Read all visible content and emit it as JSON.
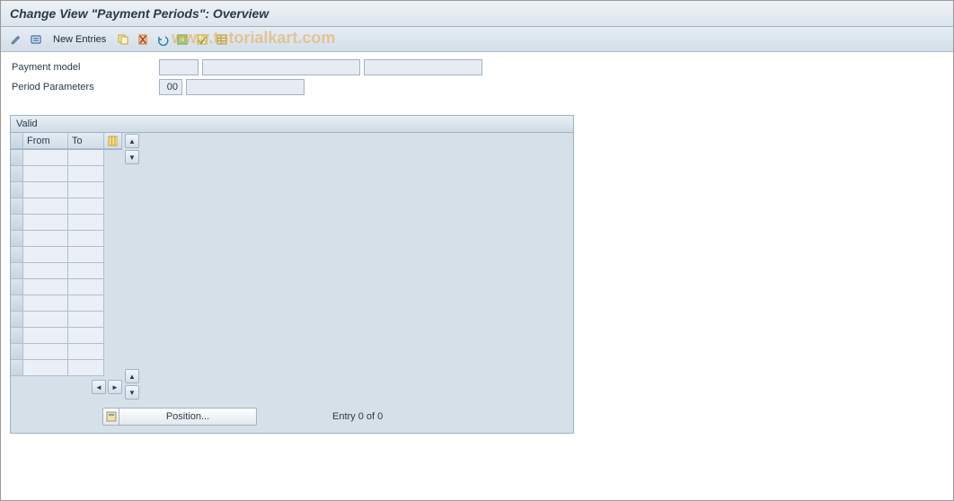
{
  "title": "Change View \"Payment Periods\": Overview",
  "watermark": "www.tutorialkart.com",
  "toolbar": {
    "new_entries": "New Entries"
  },
  "form": {
    "payment_model_label": "Payment model",
    "payment_model_code": "",
    "payment_model_desc1": "",
    "payment_model_desc2": "",
    "period_params_label": "Period Parameters",
    "period_params_code": "00",
    "period_params_desc": ""
  },
  "panel": {
    "title": "Valid",
    "col_from": "From",
    "col_to": "To"
  },
  "footer": {
    "position_label": "Position...",
    "entry_text": "Entry 0 of 0"
  }
}
